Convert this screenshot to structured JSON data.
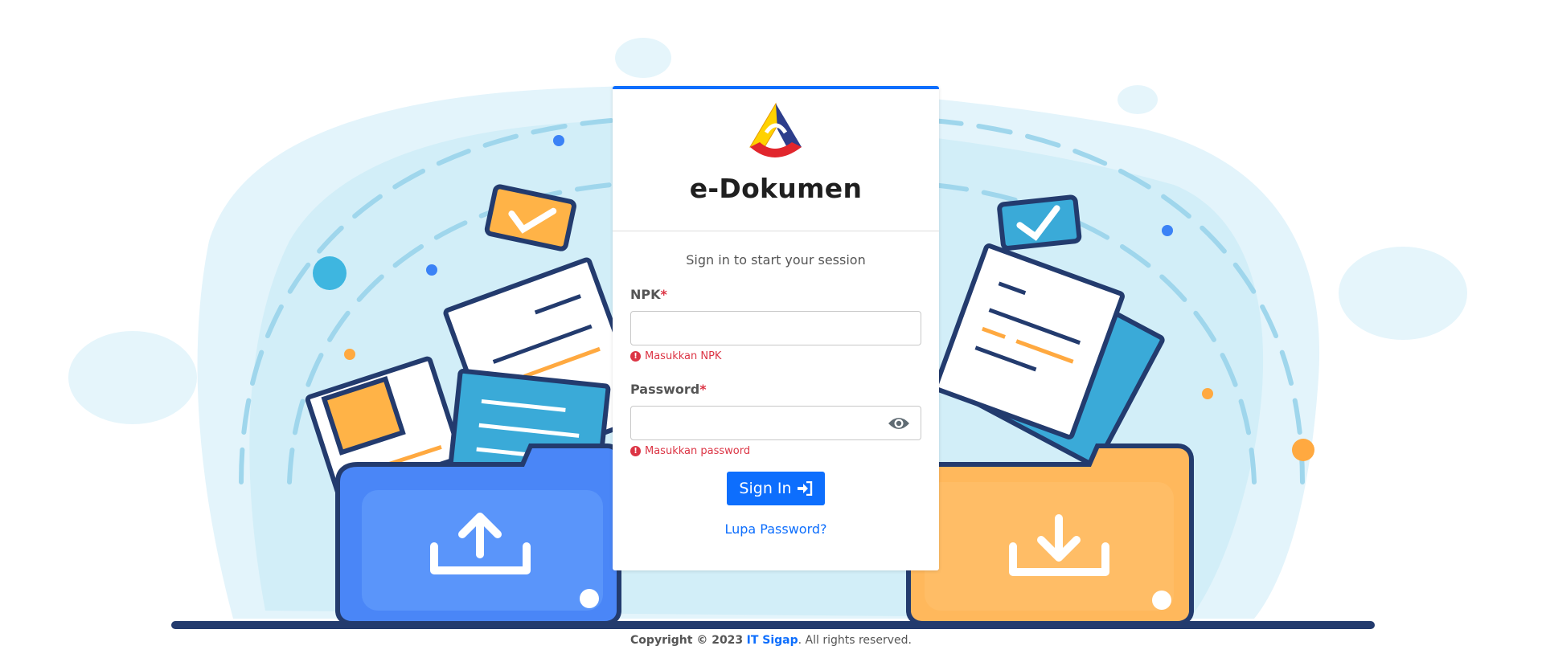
{
  "app": {
    "title": "e-Dokumen",
    "subtitle": "Sign in to start your session"
  },
  "form": {
    "npk": {
      "label": "NPK",
      "required_mark": "*",
      "value": "",
      "error": "Masukkan NPK"
    },
    "password": {
      "label": "Password",
      "required_mark": "*",
      "value": "",
      "error": "Masukkan password"
    },
    "signin_label": "Sign In",
    "forgot_label": "Lupa Password?"
  },
  "footer": {
    "copyright": "Copyright © 2023",
    "brand": "IT Sigap",
    "suffix": ". All rights reserved."
  },
  "icons": {
    "logo": "tri-color-logo-icon",
    "eye": "eye-icon",
    "error": "exclamation-circle-icon",
    "signin": "sign-in-arrow-icon",
    "upload": "upload-icon",
    "download": "download-icon"
  },
  "colors": {
    "accent": "#0d6efd",
    "error": "#dc3545",
    "folder_blue": "#4a86f7",
    "folder_orange": "#ffb85c",
    "background_blob": "#e3f4fb"
  }
}
